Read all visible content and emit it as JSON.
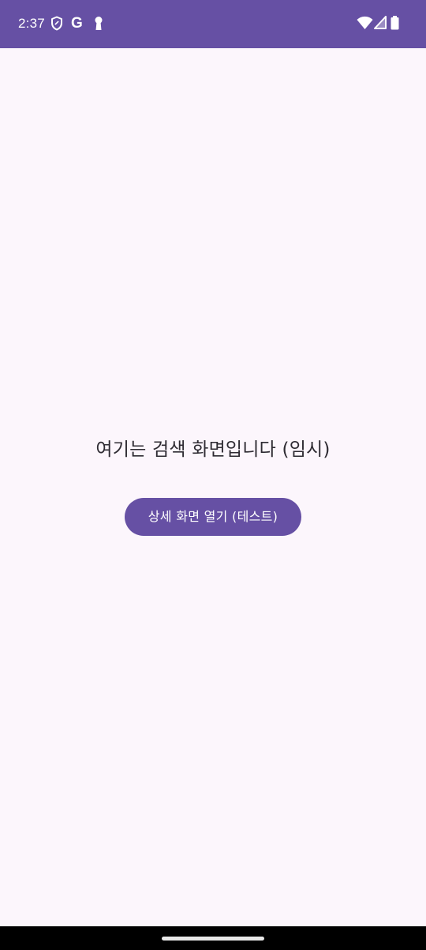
{
  "status_bar": {
    "time": "2:37",
    "google_letter": "G",
    "icons": [
      "shield-icon",
      "google-icon",
      "keyhole-icon",
      "wifi-icon",
      "signal-icon",
      "battery-icon"
    ],
    "background_color": "#6650a4"
  },
  "main": {
    "title": "여기는 검색 화면입니다 (임시)",
    "open_detail_button_label": "상세 화면 열기 (테스트)",
    "accent_color": "#6650a4",
    "background_color": "#fcf6fc"
  }
}
